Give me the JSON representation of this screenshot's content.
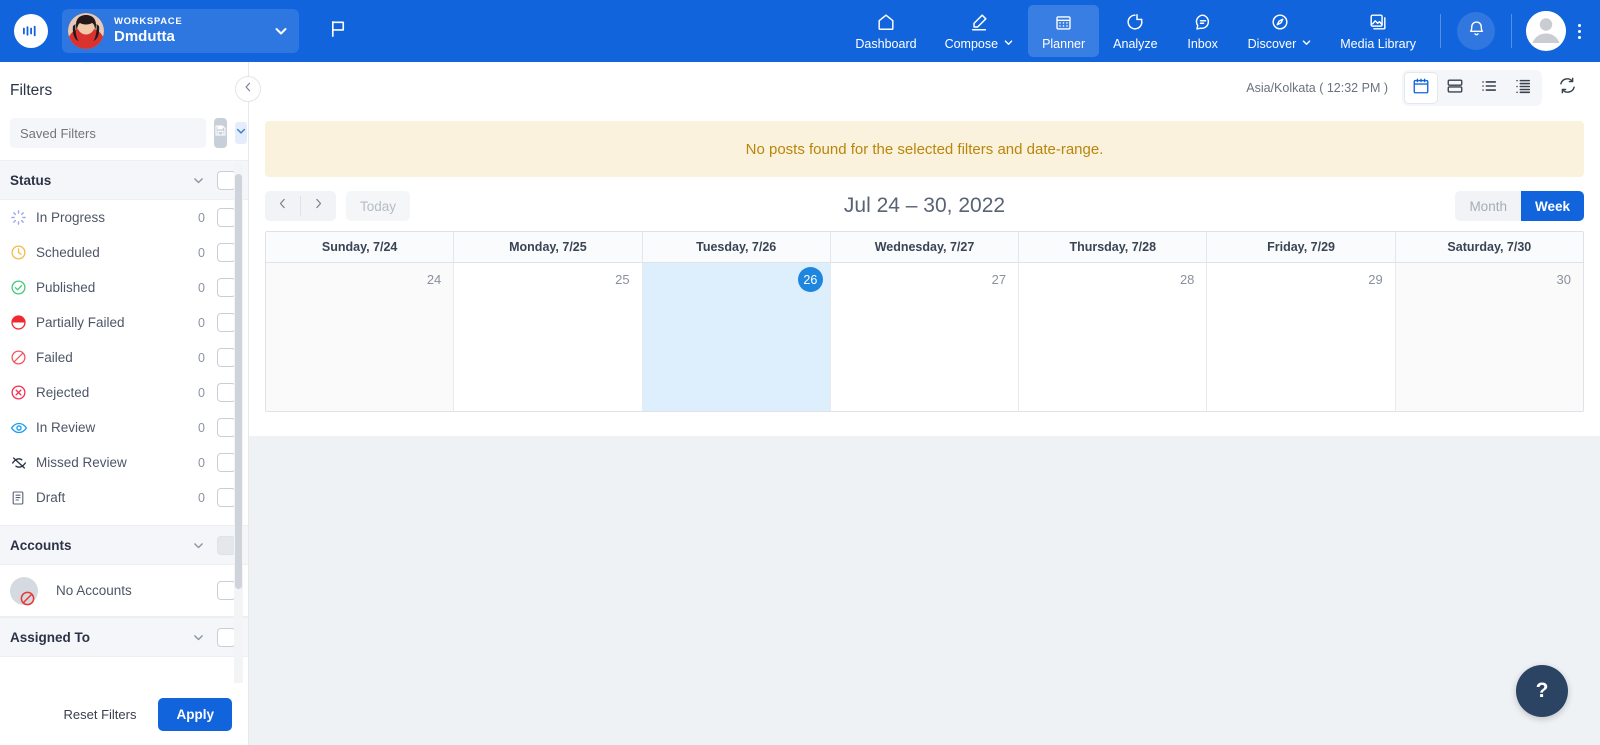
{
  "topnav": {
    "logo_icon": "app-logo-icon",
    "workspace": {
      "label": "WORKSPACE",
      "name": "Dmdutta",
      "caret_icon": "chevron-down-icon",
      "avatar_icon": "user-avatar"
    },
    "flag_icon": "flag-icon",
    "items": [
      {
        "label": "Dashboard",
        "icon": "home-icon",
        "active": false,
        "caret": false
      },
      {
        "label": "Compose",
        "icon": "pencil-icon",
        "active": false,
        "caret": true
      },
      {
        "label": "Planner",
        "icon": "calendar-icon",
        "active": true,
        "caret": false
      },
      {
        "label": "Analyze",
        "icon": "pie-chart-icon",
        "active": false,
        "caret": false
      },
      {
        "label": "Inbox",
        "icon": "chat-bubble-icon",
        "active": false,
        "caret": false
      },
      {
        "label": "Discover",
        "icon": "compass-icon",
        "active": false,
        "caret": true
      },
      {
        "label": "Media Library",
        "icon": "image-stack-icon",
        "active": false,
        "caret": false
      }
    ],
    "bell_icon": "bell-icon",
    "profile_icon": "profile-avatar-icon",
    "kebab_icon": "more-vertical-icon"
  },
  "sidebar": {
    "title": "Filters",
    "collapse_icon": "chevron-left-icon",
    "saved_filters": {
      "placeholder": "Saved Filters",
      "value": "",
      "save_icon": "save-disk-icon",
      "caret_icon": "chevron-down-icon"
    },
    "groups": [
      {
        "name": "Status",
        "caret_icon": "chevron-down-icon",
        "rows": [
          {
            "label": "In Progress",
            "count": "0",
            "icon": "spinner-icon",
            "color": "#8b9ce8"
          },
          {
            "label": "Scheduled",
            "count": "0",
            "icon": "clock-icon",
            "color": "#f5b945"
          },
          {
            "label": "Published",
            "count": "0",
            "icon": "check-circle-icon",
            "color": "#3ec97a"
          },
          {
            "label": "Partially Failed",
            "count": "0",
            "icon": "half-filled-circle-icon",
            "color": "#f0292f"
          },
          {
            "label": "Failed",
            "count": "0",
            "icon": "slash-circle-icon",
            "color": "#f0565c"
          },
          {
            "label": "Rejected",
            "count": "0",
            "icon": "x-circle-icon",
            "color": "#f22e52"
          },
          {
            "label": "In Review",
            "count": "0",
            "icon": "eye-icon",
            "color": "#1b9ff0"
          },
          {
            "label": "Missed Review",
            "count": "0",
            "icon": "eye-off-icon",
            "color": "#2b3346"
          },
          {
            "label": "Draft",
            "count": "0",
            "icon": "document-icon",
            "color": "#5a6374"
          }
        ]
      }
    ],
    "accounts": {
      "name": "Accounts",
      "caret_icon": "chevron-down-icon",
      "empty_label": "No Accounts",
      "empty_icon": "no-entry-icon"
    },
    "assigned_to": {
      "name": "Assigned To",
      "caret_icon": "chevron-down-icon"
    },
    "footer": {
      "reset_label": "Reset Filters",
      "apply_label": "Apply"
    }
  },
  "main": {
    "timezone": "Asia/Kolkata ( 12:32 PM )",
    "views": [
      {
        "icon": "calendar-view-icon",
        "active": true
      },
      {
        "icon": "split-view-icon",
        "active": false
      },
      {
        "icon": "list-view-icon",
        "active": false
      },
      {
        "icon": "detail-list-view-icon",
        "active": false
      }
    ],
    "refresh_icon": "refresh-icon",
    "banner": "No posts found for the selected filters and date-range.",
    "nav": {
      "prev_icon": "chevron-left-icon",
      "next_icon": "chevron-right-icon",
      "today_label": "Today",
      "title": "Jul 24 – 30, 2022",
      "month_label": "Month",
      "week_label": "Week",
      "active_range": "Week"
    },
    "help_label": "?"
  },
  "calendar": {
    "columns": [
      {
        "header": "Sunday, 7/24",
        "day": "24",
        "weekend": true,
        "today": false
      },
      {
        "header": "Monday, 7/25",
        "day": "25",
        "weekend": false,
        "today": false
      },
      {
        "header": "Tuesday, 7/26",
        "day": "26",
        "weekend": false,
        "today": true
      },
      {
        "header": "Wednesday, 7/27",
        "day": "27",
        "weekend": false,
        "today": false
      },
      {
        "header": "Thursday, 7/28",
        "day": "28",
        "weekend": false,
        "today": false
      },
      {
        "header": "Friday, 7/29",
        "day": "29",
        "weekend": false,
        "today": false
      },
      {
        "header": "Saturday, 7/30",
        "day": "30",
        "weekend": true,
        "today": false
      }
    ]
  },
  "colors": {
    "brand_blue": "#1264DC",
    "today_cell": "#ddeefc",
    "today_pill": "#1f86e0",
    "banner_bg": "#fbf2dd",
    "banner_text": "#b8860b",
    "help_fab": "#2c4464"
  }
}
